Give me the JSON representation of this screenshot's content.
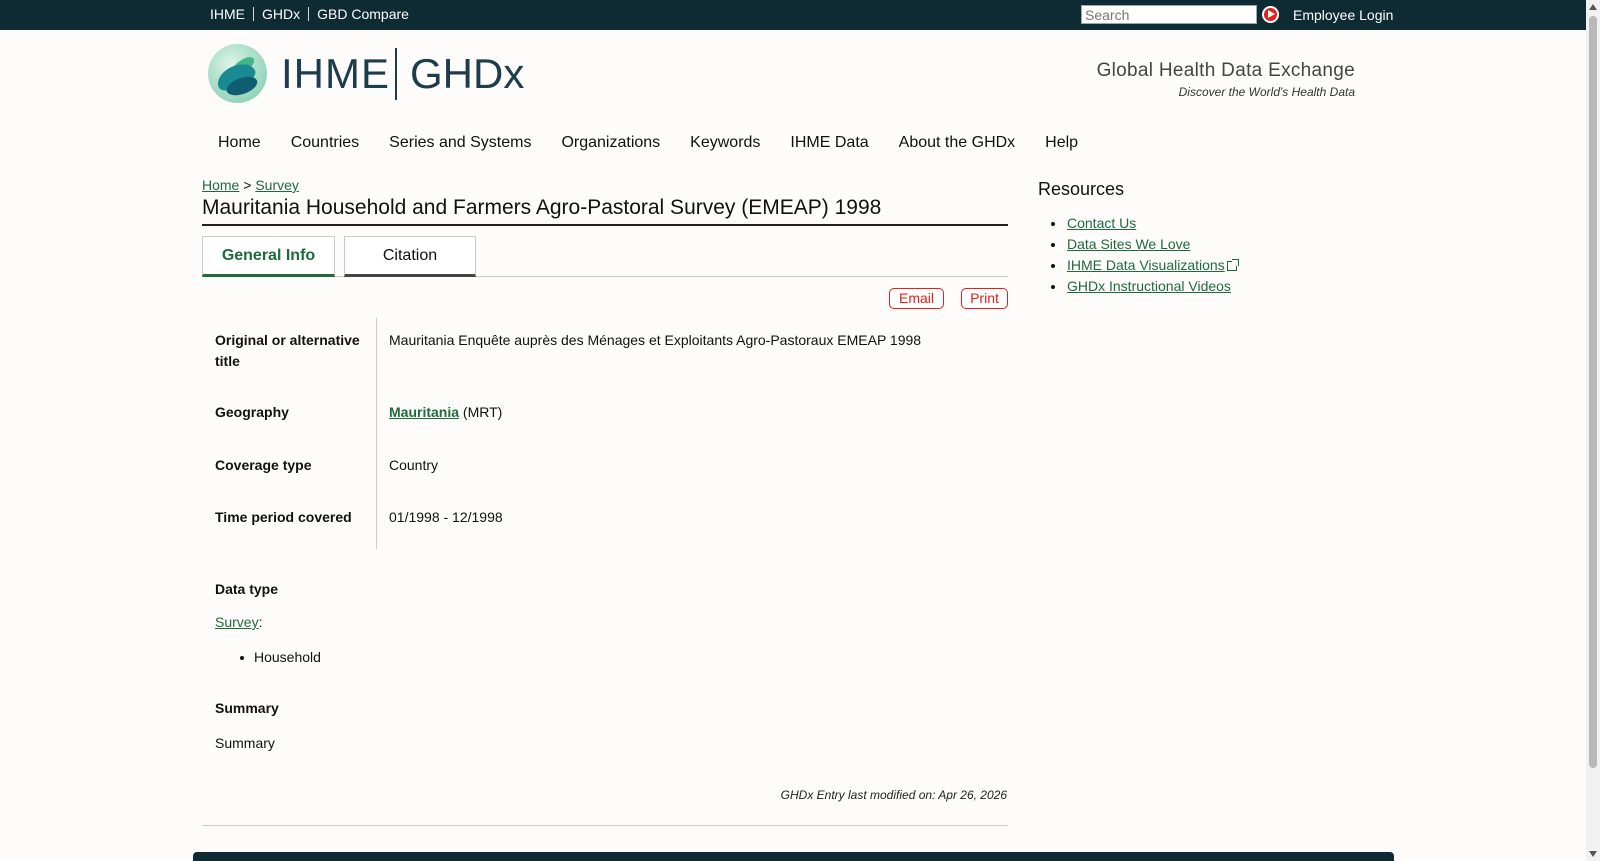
{
  "topbar": {
    "links": [
      "IHME",
      "GHDx",
      "GBD Compare"
    ],
    "search_placeholder": "Search",
    "employee_login": "Employee Login"
  },
  "header": {
    "logo_ihme": "IHME",
    "logo_ghdx": "GHDx",
    "tagline_main": "Global Health Data Exchange",
    "tagline_sub": "Discover the World's Health Data"
  },
  "nav": [
    "Home",
    "Countries",
    "Series and Systems",
    "Organizations",
    "Keywords",
    "IHME Data",
    "About the GHDx",
    "Help"
  ],
  "breadcrumb": {
    "home": "Home",
    "sep": ">",
    "survey": "Survey"
  },
  "page_title": "Mauritania Household and Farmers Agro-Pastoral Survey (EMEAP) 1998",
  "tabs": [
    "General Info",
    "Citation"
  ],
  "actions": {
    "email": "Email",
    "print": "Print"
  },
  "info": {
    "alt_title_label": "Original or alternative title",
    "alt_title_value": "Mauritania Enquête auprès des Ménages et Exploitants Agro-Pastoraux EMEAP 1998",
    "geography_label": "Geography",
    "geography_link": "Mauritania",
    "geography_code": "(MRT)",
    "coverage_label": "Coverage type",
    "coverage_value": "Country",
    "time_label": "Time period covered",
    "time_value": "01/1998 - 12/1998"
  },
  "data_type": {
    "label": "Data type",
    "link": "Survey",
    "colon": ":",
    "items": [
      "Household"
    ]
  },
  "summary": {
    "label": "Summary",
    "text": "Summary"
  },
  "modified": "GHDx Entry last modified on: Apr 26, 2026",
  "resources": {
    "title": "Resources",
    "items": [
      "Contact Us",
      "Data Sites We Love",
      "IHME Data Visualizations",
      "GHDx Instructional Videos"
    ]
  },
  "colors": {
    "topbar": "#0e2a33",
    "link": "#1f6a3d",
    "accent_red": "#e3201b"
  }
}
